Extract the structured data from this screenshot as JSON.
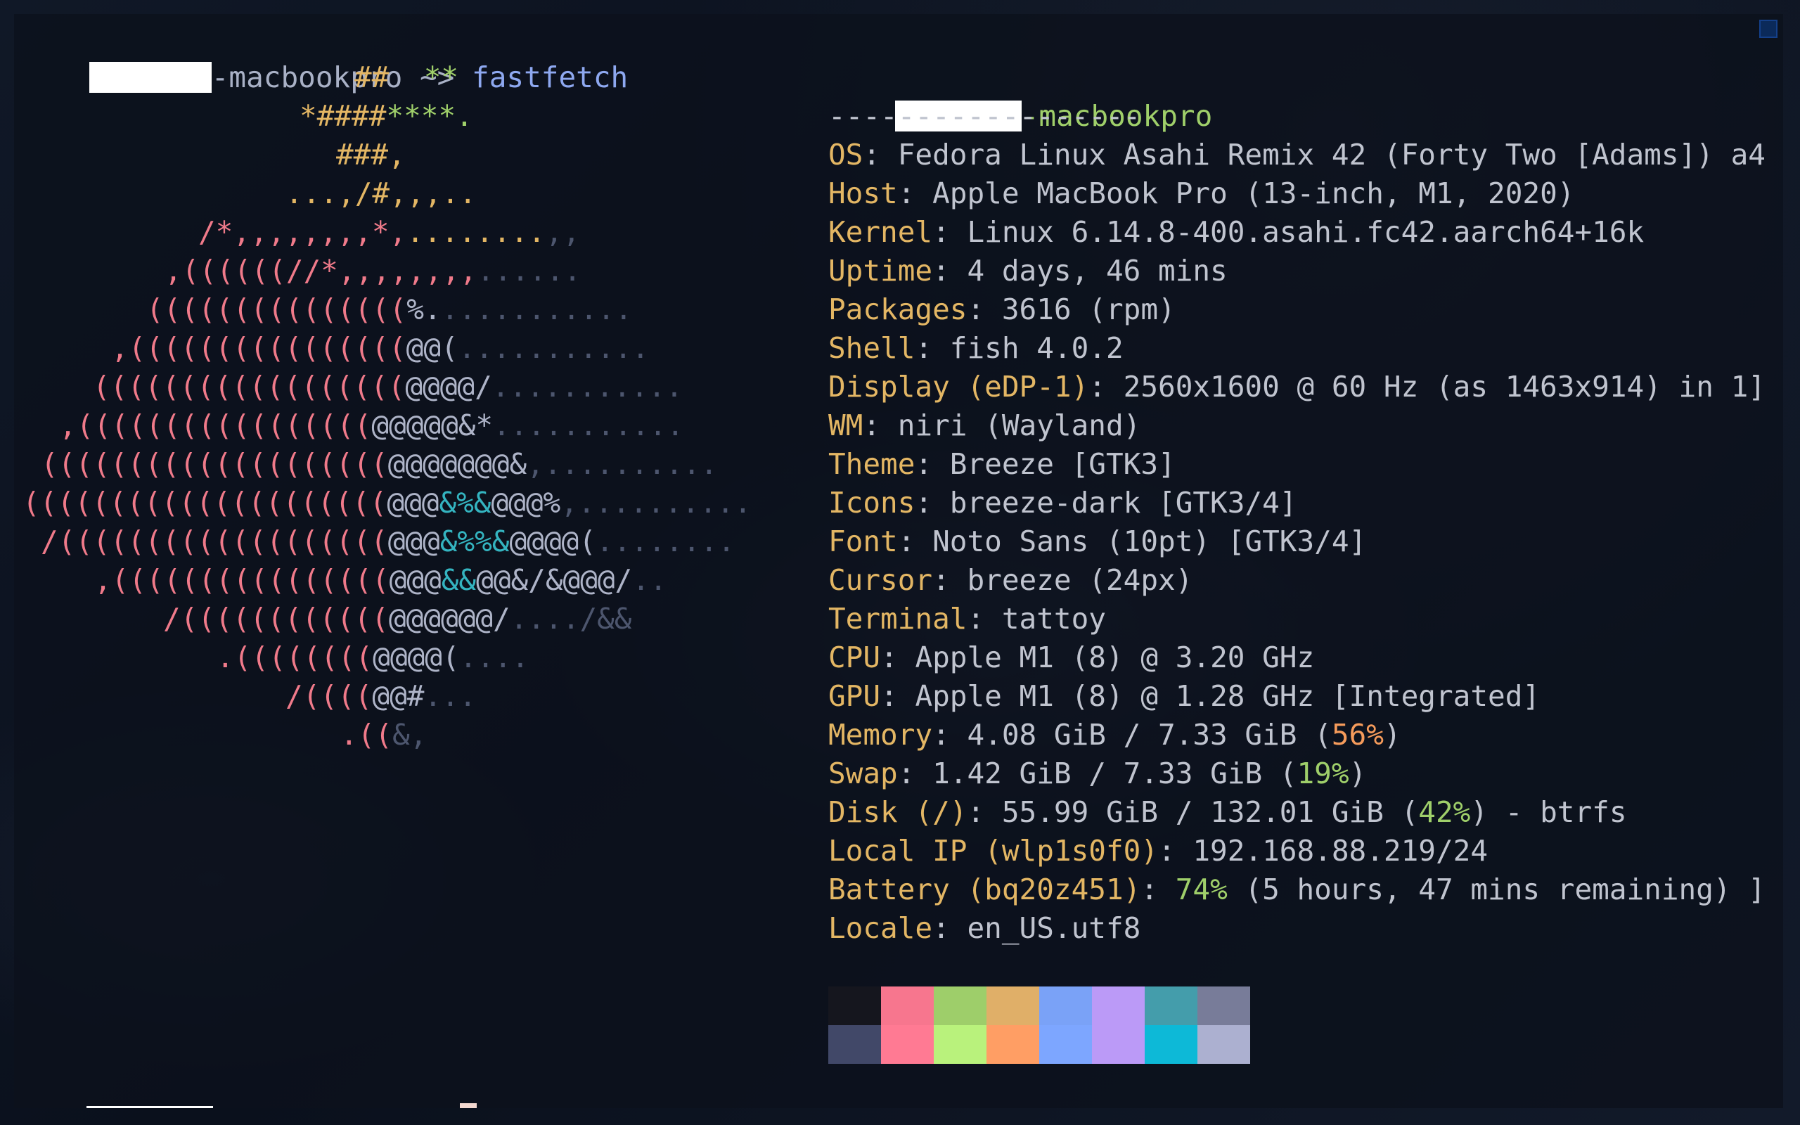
{
  "prompt": {
    "host_suffix": "-macbookpro",
    "symbol": "~>",
    "command": "fastfetch"
  },
  "logo_lines": [
    [
      [
        "y",
        "##  "
      ],
      [
        "g",
        "**"
      ]
    ],
    [
      [
        "y",
        "*####"
      ],
      [
        "g",
        "****."
      ]
    ],
    [
      [
        "y",
        "###,"
      ]
    ],
    [
      [
        "y",
        "...,/#,,,.."
      ]
    ],
    [
      [
        "p",
        "/*,,,,,,,,*,"
      ],
      [
        "y",
        "........"
      ],
      [
        "d",
        ",,"
      ]
    ],
    [
      [
        "p",
        ",((((((//*,,,,,,,,"
      ],
      [
        "d",
        "......"
      ]
    ],
    [
      [
        "p",
        "((((((((((((((("
      ],
      [
        "w",
        "%."
      ],
      [
        "d",
        "..........."
      ]
    ],
    [
      [
        "p",
        ",(((((((((((((((("
      ],
      [
        "w",
        "@@("
      ],
      [
        "d",
        "..........."
      ]
    ],
    [
      [
        "p",
        "(((((((((((((((((("
      ],
      [
        "w",
        "@@@@/"
      ],
      [
        "d",
        "..........."
      ]
    ],
    [
      [
        "p",
        ",((((((((((((((((("
      ],
      [
        "w",
        "@@@@@&*"
      ],
      [
        "d",
        "..........."
      ]
    ],
    [
      [
        "p",
        "(((((((((((((((((((("
      ],
      [
        "w",
        "@@@@@@@&"
      ],
      [
        "d",
        ",.........."
      ]
    ],
    [
      [
        "p",
        "((((((((((((((((((((("
      ],
      [
        "w",
        "@@@"
      ],
      [
        "c",
        "&%&"
      ],
      [
        "w",
        "@@@%"
      ],
      [
        "d",
        ",.........."
      ]
    ],
    [
      [
        "p",
        "/((((((((((((((((((("
      ],
      [
        "w",
        "@@@"
      ],
      [
        "c",
        "&%%&"
      ],
      [
        "w",
        "@@@@("
      ],
      [
        "d",
        "........"
      ]
    ],
    [
      [
        "p",
        ",(((((((((((((((("
      ],
      [
        "w",
        "@@@"
      ],
      [
        "c",
        "&&"
      ],
      [
        "w",
        "@@&/&@@@/"
      ],
      [
        "d",
        ".."
      ]
    ],
    [
      [
        "p",
        "/(((((((((((("
      ],
      [
        "w",
        "@@@@@@/"
      ],
      [
        "d",
        "..../&&"
      ]
    ],
    [
      [
        "p",
        ".(((((((("
      ],
      [
        "w",
        "@@@@("
      ],
      [
        "d",
        "...."
      ]
    ],
    [
      [
        "p",
        "/(((("
      ],
      [
        "w",
        "@@#"
      ],
      [
        "d",
        "..."
      ]
    ],
    [
      [
        "p",
        ".(("
      ],
      [
        "d",
        "&,"
      ]
    ]
  ],
  "info": {
    "title_suffix": "-macbookpro",
    "separator": "------------------",
    "rows": [
      {
        "key": "OS",
        "value": "Fedora Linux Asahi Remix 42 (Forty Two [Adams]) a4"
      },
      {
        "key": "Host",
        "value": "Apple MacBook Pro (13-inch, M1, 2020)"
      },
      {
        "key": "Kernel",
        "value": "Linux 6.14.8-400.asahi.fc42.aarch64+16k"
      },
      {
        "key": "Uptime",
        "value": "4 days, 46 mins"
      },
      {
        "key": "Packages",
        "value": "3616 (rpm)"
      },
      {
        "key": "Shell",
        "value": "fish 4.0.2"
      },
      {
        "key": "Display (eDP-1)",
        "value": "2560x1600 @ 60 Hz (as 1463x914) in 1]"
      },
      {
        "key": "WM",
        "value": "niri (Wayland)"
      },
      {
        "key": "Theme",
        "value": "Breeze [GTK3]"
      },
      {
        "key": "Icons",
        "value": "breeze-dark [GTK3/4]"
      },
      {
        "key": "Font",
        "value": "Noto Sans (10pt) [GTK3/4]"
      },
      {
        "key": "Cursor",
        "value": "breeze (24px)"
      },
      {
        "key": "Terminal",
        "value": "tattoy"
      },
      {
        "key": "CPU",
        "value": "Apple M1 (8) @ 3.20 GHz"
      },
      {
        "key": "GPU",
        "value": "Apple M1 (8) @ 1.28 GHz [Integrated]"
      },
      {
        "key": "Memory",
        "pre": "4.08 GiB / 7.33 GiB (",
        "pct": "56%",
        "pct_color": "orange",
        "post": ")"
      },
      {
        "key": "Swap",
        "pre": "1.42 GiB / 7.33 GiB (",
        "pct": "19%",
        "pct_color": "green",
        "post": ")"
      },
      {
        "key": "Disk (/)",
        "pre": "55.99 GiB / 132.01 GiB (",
        "pct": "42%",
        "pct_color": "green",
        "post": ") - btrfs"
      },
      {
        "key": "Local IP (wlp1s0f0)",
        "value": "192.168.88.219/24"
      },
      {
        "key": "Battery (bq20z451)",
        "pre": "",
        "pct": "74%",
        "pct_color": "green",
        "post": " (5 hours, 47 mins remaining) ]"
      },
      {
        "key": "Locale",
        "value": "en_US.utf8"
      }
    ]
  },
  "palette": {
    "top": [
      "#15161e",
      "#f7768e",
      "#9ece6a",
      "#e0af68",
      "#7aa2f7",
      "#bb9af7",
      "#449dab",
      "#787c99"
    ],
    "bottom": [
      "#414868",
      "#ff7a93",
      "#b9f27c",
      "#ff9e64",
      "#7da6ff",
      "#bb9af7",
      "#0db9d7",
      "#acb0d0"
    ]
  },
  "colors": {
    "logo": {
      "y": "#e3b664",
      "g": "#9fcf6a",
      "p": "#f07a8a",
      "w": "#aeb4c8",
      "c": "#34b4c0",
      "d": "#4d566e"
    },
    "pct": {
      "orange": "#f59b5b",
      "green": "#9fcf6a"
    }
  }
}
